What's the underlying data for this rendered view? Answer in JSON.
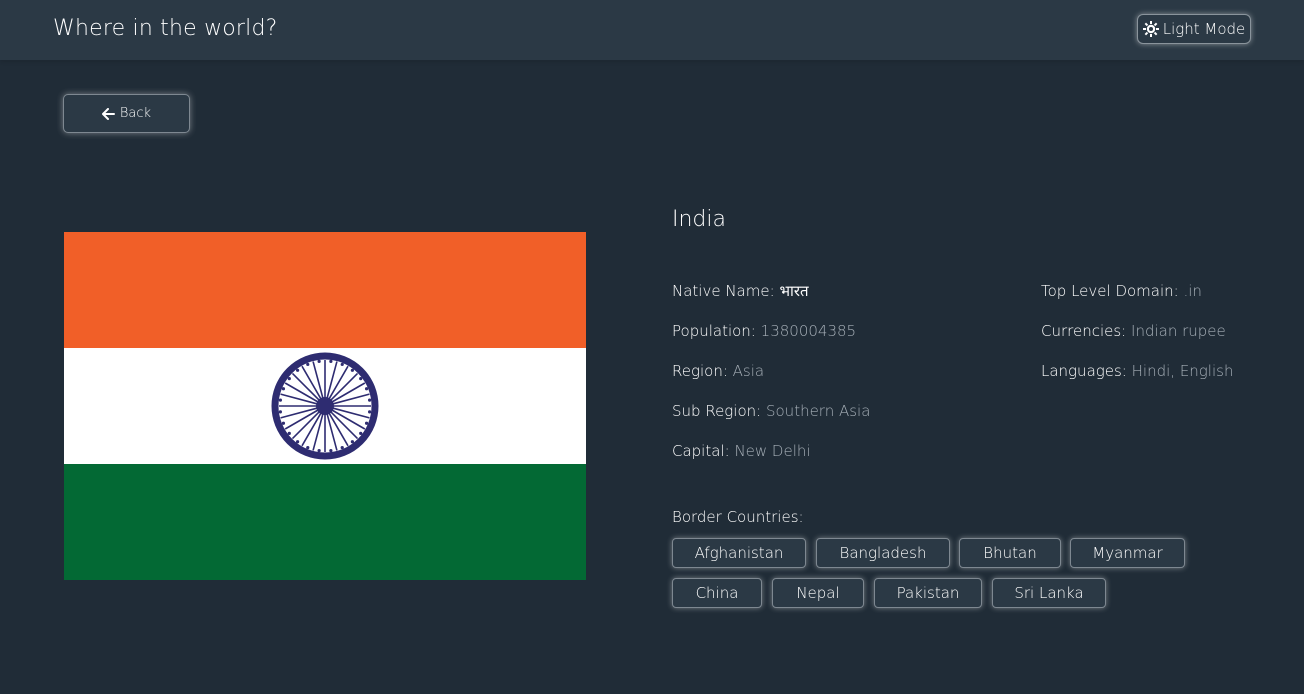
{
  "header": {
    "title": "Where in the world?",
    "mode_toggle_label": "Light Mode",
    "mode_toggle_icon": "sun-icon"
  },
  "back_button": {
    "label": "Back",
    "icon": "arrow-left-icon"
  },
  "flag": {
    "icon": "india-flag",
    "colors": {
      "saffron": "#f15f28",
      "white": "#ffffff",
      "green": "#036934",
      "chakra": "#2e2c71"
    }
  },
  "country": {
    "name": "India",
    "details_left": [
      {
        "label": "Native Name:",
        "value": "भारत"
      },
      {
        "label": "Population:",
        "value": "1380004385"
      },
      {
        "label": "Region:",
        "value": "Asia"
      },
      {
        "label": "Sub Region:",
        "value": "Southern Asia"
      },
      {
        "label": "Capital:",
        "value": "New Delhi"
      }
    ],
    "details_right": [
      {
        "label": "Top Level Domain:",
        "value": ".in"
      },
      {
        "label": "Currencies:",
        "value": "Indian rupee"
      },
      {
        "label": "Languages:",
        "value": "Hindi, English"
      }
    ],
    "border_countries_label": "Border Countries:",
    "border_countries": [
      "Afghanistan",
      "Bangladesh",
      "Bhutan",
      "Myanmar",
      "China",
      "Nepal",
      "Pakistan",
      "Sri Lanka"
    ]
  },
  "colors": {
    "background": "#202c37",
    "element": "#2b3945",
    "muted_text": "#a7b0b8"
  }
}
